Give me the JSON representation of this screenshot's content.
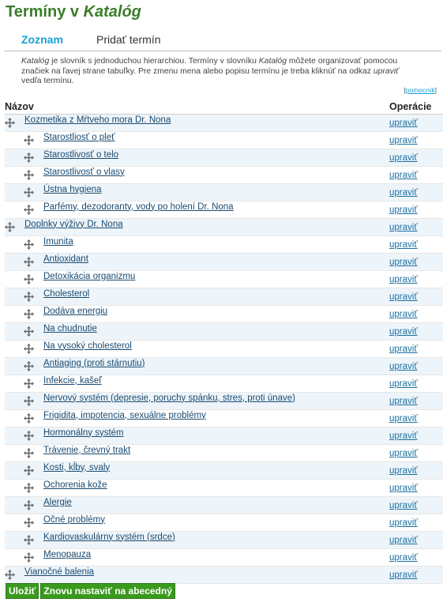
{
  "page": {
    "title_prefix": "Termíny v ",
    "title_vocab": "Katalóg"
  },
  "tabs": [
    {
      "label": "Zoznam",
      "active": true
    },
    {
      "label": "Pridať termín",
      "active": false
    }
  ],
  "help": {
    "vocab_word": "Katalóg",
    "part1": " je slovník s jednoduchou hierarchiou. Termíny v slovníku ",
    "vocab_word2": "Katalóg",
    "part2": " môžete organizovať pomocou značiek na ľavej strane tabuľky. Pre zmenu mena alebo popisu termínu je treba kliknúť na odkaz ",
    "edit_word": "upraviť",
    "part3": " vedľa termínu.",
    "more_help_label": "pomocník"
  },
  "table": {
    "col_name": "Názov",
    "col_ops": "Operácie",
    "edit_label": "upraviť",
    "rows": [
      {
        "name": "Kozmetika z Mŕtveho mora Dr. Nona",
        "depth": 0
      },
      {
        "name": "Starostliosť o pleť",
        "depth": 1
      },
      {
        "name": "Starostlivosť o telo",
        "depth": 1
      },
      {
        "name": "Starostlivosť o vlasy",
        "depth": 1
      },
      {
        "name": "Ústna hygiena",
        "depth": 1
      },
      {
        "name": "Parfémy, dezodoranty, vody po holení Dr. Nona",
        "depth": 1
      },
      {
        "name": "Doplnky výživy Dr. Nona",
        "depth": 0
      },
      {
        "name": "Imunita",
        "depth": 1
      },
      {
        "name": "Antioxidant",
        "depth": 1
      },
      {
        "name": "Detoxikácia organizmu",
        "depth": 1
      },
      {
        "name": "Cholesterol",
        "depth": 1
      },
      {
        "name": "Dodáva energiu",
        "depth": 1
      },
      {
        "name": "Na chudnutie",
        "depth": 1
      },
      {
        "name": "Na vysoký cholesterol",
        "depth": 1
      },
      {
        "name": "Antiaging (proti stárnutiu)",
        "depth": 1
      },
      {
        "name": "Infekcie, kašeľ",
        "depth": 1
      },
      {
        "name": "Nervový systém (depresie, poruchy spánku, stres, proti únave)",
        "depth": 1
      },
      {
        "name": "Frigidita, impotencia, sexuálne problémy",
        "depth": 1
      },
      {
        "name": "Hormonálny systém",
        "depth": 1
      },
      {
        "name": "Trávenie, črevný trakt",
        "depth": 1
      },
      {
        "name": "Kosti, kĺby, svaly",
        "depth": 1
      },
      {
        "name": "Ochorenia kože",
        "depth": 1
      },
      {
        "name": "Alergie",
        "depth": 1
      },
      {
        "name": "Očné problémy",
        "depth": 1
      },
      {
        "name": "Kardiovaskulárny systém (srdce)",
        "depth": 1
      },
      {
        "name": "Menopauza",
        "depth": 1
      },
      {
        "name": "Vianočné balenia",
        "depth": 0
      }
    ]
  },
  "buttons": {
    "save_label": "Uložiť",
    "reset_label": "Znovu nastaviť na abecedný"
  },
  "colors": {
    "title_green": "#3a7d2a",
    "tab_active_blue": "#1aa1d6",
    "row_alt": "#eef5fa",
    "button_green": "#3a9a1e"
  },
  "icons": {
    "drag_handle": "move-arrows-icon"
  }
}
